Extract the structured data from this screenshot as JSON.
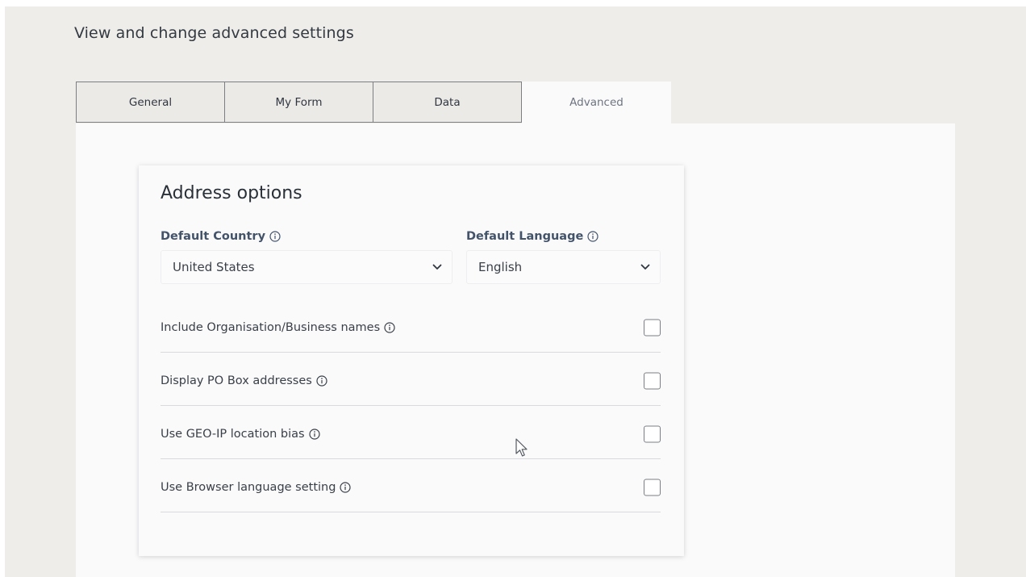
{
  "page": {
    "heading": "View and change advanced settings"
  },
  "tabs": [
    {
      "label": "General"
    },
    {
      "label": "My Form"
    },
    {
      "label": "Data"
    },
    {
      "label": "Advanced",
      "active": true
    }
  ],
  "address_options": {
    "title": "Address options",
    "default_country": {
      "label": "Default Country",
      "value": "United States",
      "icon": "info-icon"
    },
    "default_language": {
      "label": "Default Language",
      "value": "English",
      "icon": "info-icon"
    },
    "options": [
      {
        "label": "Include Organisation/Business names",
        "checked": false
      },
      {
        "label": "Display PO Box addresses",
        "checked": false
      },
      {
        "label": "Use GEO-IP location bias",
        "checked": false
      },
      {
        "label": "Use Browser language setting",
        "checked": false
      }
    ]
  },
  "colors": {
    "background": "#efedea",
    "panel": "#fafafb",
    "label_accent": "#43536a",
    "tab_border": "#7c7e82"
  }
}
